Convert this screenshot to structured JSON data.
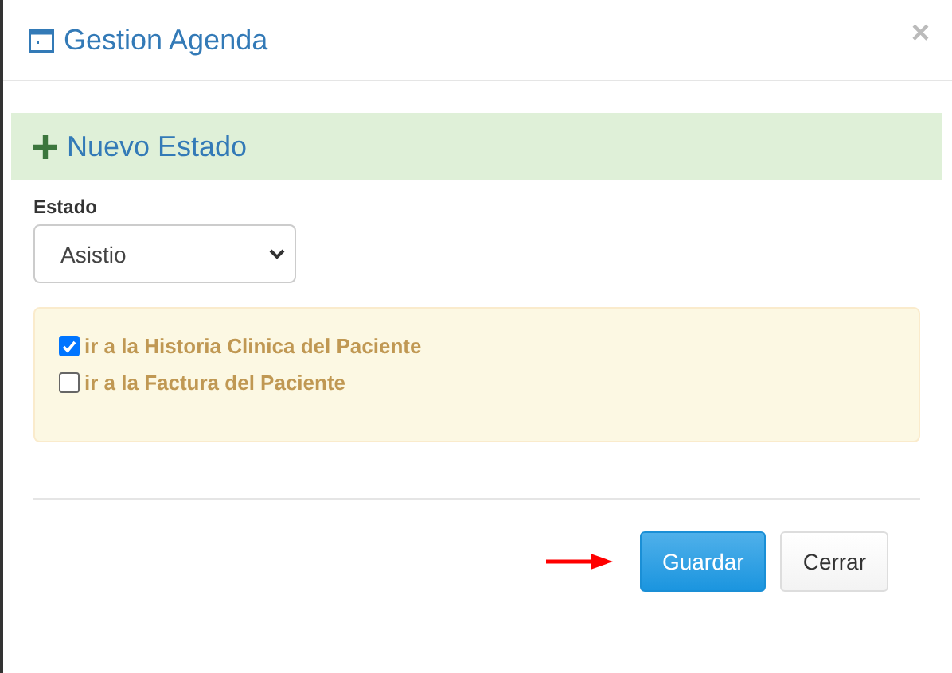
{
  "window": {
    "title": "Gestion Agenda",
    "close": "×"
  },
  "banner": {
    "title": "Nuevo Estado"
  },
  "estado": {
    "label": "Estado",
    "value": "Asistio"
  },
  "options": [
    {
      "label": "ir a la Historia Clinica del Paciente",
      "checked": true
    },
    {
      "label": "ir a la Factura del Paciente",
      "checked": false
    }
  ],
  "buttons": [
    {
      "label": "Guardar",
      "kind": "primary"
    },
    {
      "label": "Cerrar",
      "kind": "default"
    }
  ]
}
